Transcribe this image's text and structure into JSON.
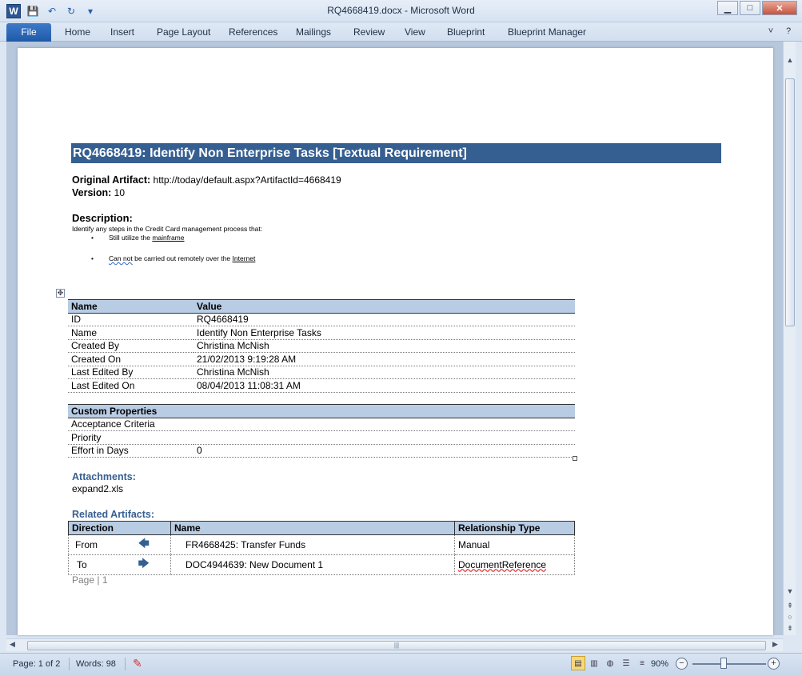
{
  "window": {
    "title": "RQ4668419.docx - Microsoft Word",
    "controls": {
      "minimize": "▁",
      "maximize": "□",
      "close": "✕"
    }
  },
  "qat": {
    "app_icon": "W",
    "save": "💾",
    "undo": "↶",
    "redo": "↻",
    "more": "▾"
  },
  "ribbon": {
    "file_tab": "File",
    "tabs": [
      "Home",
      "Insert",
      "Page Layout",
      "References",
      "Mailings",
      "Review",
      "View",
      "Blueprint",
      "Blueprint Manager"
    ],
    "help_icon": "?",
    "expand_icon": "˅"
  },
  "document": {
    "title": "RQ4668419: Identify Non Enterprise Tasks [Textual Requirement]",
    "original_artifact_label": "Original Artifact:",
    "original_artifact_value": "http://today/default.aspx?ArtifactId=4668419",
    "version_label": "Version:",
    "version_value": "10",
    "description_label": "Description:",
    "description_text": "Identify any steps in the Credit Card management process that:",
    "bullets": [
      {
        "pre": "Still utilize the ",
        "link": "mainframe",
        "post": ""
      },
      {
        "pre": "",
        "link": "Can not",
        "post": " be carried out remotely over the ",
        "link2": "Internet"
      }
    ],
    "props_table": {
      "headers": [
        "Name",
        "Value"
      ],
      "rows": [
        [
          "ID",
          "RQ4668419"
        ],
        [
          "Name",
          "Identify Non Enterprise Tasks"
        ],
        [
          "Created By",
          "Christina McNish"
        ],
        [
          "Created On",
          "21/02/2013 9:19:28 AM"
        ],
        [
          "Last Edited By",
          "Christina McNish"
        ],
        [
          "Last Edited On",
          "08/04/2013 11:08:31 AM"
        ]
      ]
    },
    "custom_table": {
      "header": "Custom Properties",
      "rows": [
        [
          "Acceptance Criteria",
          ""
        ],
        [
          "Priority",
          ""
        ],
        [
          "Effort in Days",
          "0"
        ]
      ]
    },
    "attachments_label": "Attachments:",
    "attachment_file": "expand2.xls",
    "related_label": "Related Artifacts:",
    "related_table": {
      "headers": [
        "Direction",
        "Name",
        "Relationship Type"
      ],
      "rows": [
        {
          "direction": "From",
          "arrow": "🡄",
          "name": "FR4668425: Transfer Funds",
          "type": "Manual"
        },
        {
          "direction": "To",
          "arrow": "🡆",
          "name": "DOC4944639: New Document 1",
          "type": "DocumentReference"
        }
      ]
    },
    "footer_page_label": "Page",
    "footer_sep": "|",
    "footer_page_num": "1"
  },
  "statusbar": {
    "page": "Page: 1 of 2",
    "words": "Words: 98",
    "zoom": "90%",
    "zoom_minus": "−",
    "zoom_plus": "+"
  }
}
